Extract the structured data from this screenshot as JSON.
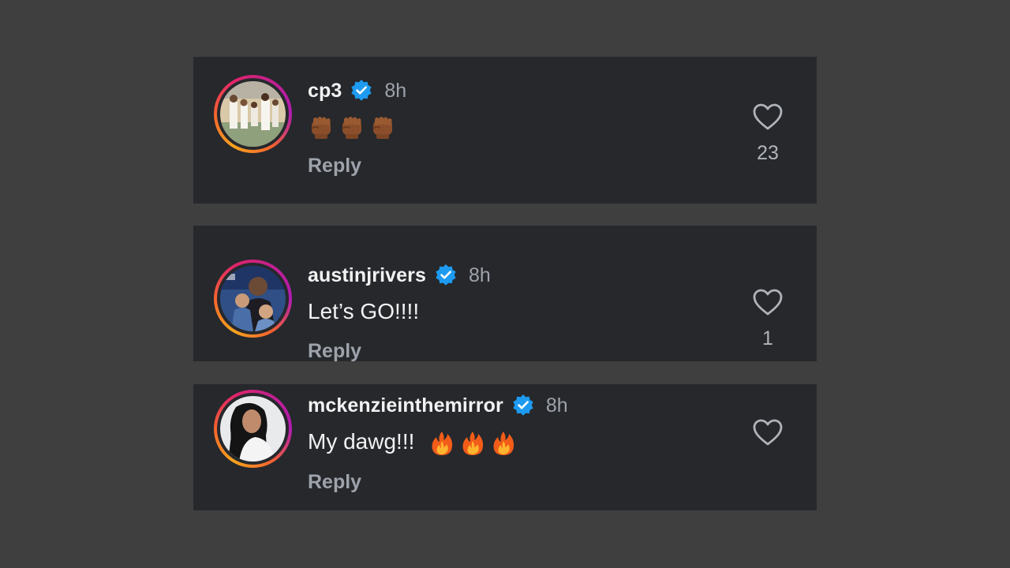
{
  "comments": [
    {
      "username": "cp3",
      "time": "8h",
      "text": "",
      "emoji": [
        "raised-fist-emoji",
        "raised-fist-emoji",
        "raised-fist-emoji"
      ],
      "reply_label": "Reply",
      "like_count": "23",
      "verified": true
    },
    {
      "username": "austinjrivers",
      "time": "8h",
      "text": "Let’s GO!!!!",
      "emoji": [],
      "reply_label": "Reply",
      "like_count": "1",
      "verified": true
    },
    {
      "username": "mckenzieinthemirror",
      "time": "8h",
      "text": "My dawg!!!",
      "emoji": [
        "fire-emoji",
        "fire-emoji",
        "fire-emoji"
      ],
      "reply_label": "Reply",
      "like_count": "",
      "verified": true
    }
  ],
  "colors": {
    "page_background": "#3f3f3f",
    "card_background": "#26282c",
    "verified_blue": "#1d9bf0",
    "username_text": "#f2f2f2",
    "secondary_text": "#9ea3ab"
  }
}
